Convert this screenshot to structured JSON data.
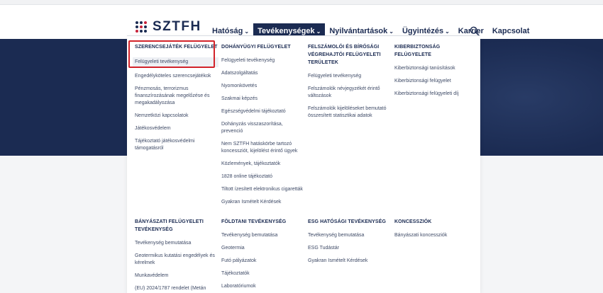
{
  "header": {
    "logo_text": "SZTFH",
    "nav": [
      {
        "label": "Hatóság",
        "chevron": "⌄",
        "active": false
      },
      {
        "label": "Tevékenységek",
        "chevron": "⌄",
        "active": true
      },
      {
        "label": "Nyilvántartások",
        "chevron": "⌄",
        "active": false
      },
      {
        "label": "Ügyintézés",
        "chevron": "⌄",
        "active": false
      },
      {
        "label": "Karrier",
        "chevron": "",
        "active": false
      },
      {
        "label": "Kapcsolat",
        "chevron": "",
        "active": false
      }
    ],
    "search_icon": "search-icon"
  },
  "mega_menu": {
    "columns": [
      {
        "heading": "SZERENCSEJÁTÉK FELÜGYELET",
        "links": [
          "Felügyeleti tevékenység",
          "Engedélyköteles szerencsejátékok",
          "Pénzmosás, terrorizmus finanszírozásának megelőzése és megakadályozása",
          "Nemzetközi kapcsolatok",
          "Játékosvédelem",
          "Tájékoztató játékosvédelmi támogatásról"
        ]
      },
      {
        "heading": "DOHÁNYÜGYI FELÜGYELET",
        "links": [
          "Felügyeleti tevékenység",
          "Adatszolgáltatás",
          "Nyomonkövetés",
          "Szakmai képzés",
          "Egészségvédelmi tájékoztató",
          "Dohányzás visszaszorítása, prevenció",
          "Nem SZTFH hatáskörbe tartozó koncessziót, kijelölést érintő ügyek",
          "Közlemények, tájékoztatók",
          "1828 online tájékoztató",
          "Tiltott ízesített elektronikus cigaretták",
          "Gyakran Ismételt Kérdések"
        ]
      },
      {
        "heading": "FELSZÁMOLÓI ÉS BÍRÓSÁGI VÉGREHAJTÓI FELÜGYELETI TERÜLETEK",
        "links": [
          "Felügyeleti tevékenység",
          "Felszámolók névjegyzékét érintő változások",
          "Felszámolók kijelöléseket bemutató összesített statisztikai adatok"
        ]
      },
      {
        "heading": "KIBERBIZTONSÁG FELÜGYELETE",
        "links": [
          "Kiberbiztonsági tanúsítások",
          "Kiberbiztonsági felügyelet",
          "Kiberbiztonsági felügyeleti díj"
        ]
      },
      {
        "heading": "BÁNYÁSZATI FELÜGYELETI TEVÉKENYSÉG",
        "links": [
          "Tevékenység bemutatása",
          "Geotermikus kutatási engedélyek és kérelmek",
          "Munkavédelem",
          "(EU) 2024/1787 rendelet (Metán"
        ]
      },
      {
        "heading": "FÖLDTANI TEVÉKENYSÉG",
        "links": [
          "Tevékenység bemutatása",
          "Geotermia",
          "Futó pályázatok",
          "Tájékoztatók",
          "Laboratóriumok"
        ]
      },
      {
        "heading": "ESG HATÓSÁGI TEVÉKENYSÉG",
        "links": [
          "Tevékenység bemutatása",
          "ESG Tudástár",
          "Gyakran Ismételt Kérdések"
        ]
      },
      {
        "heading": "KONCESSZIÓK",
        "links": [
          "Bányászati koncessziók"
        ]
      }
    ]
  }
}
